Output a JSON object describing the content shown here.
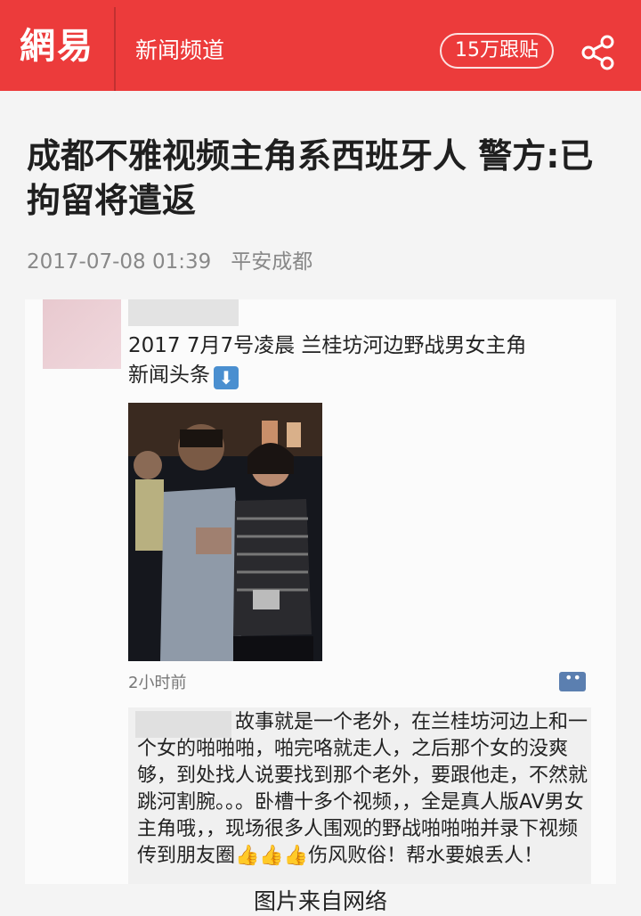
{
  "header": {
    "logo": "網易",
    "channel": "新闻频道",
    "comments": "15万跟贴",
    "share_icon": "share-icon",
    "background": "#ec3b3b"
  },
  "article": {
    "title": "成都不雅视频主角系西班牙人 警方:已拘留将遣返",
    "date": "2017-07-08 01:39",
    "source": "平安成都"
  },
  "screenshot": {
    "post_line1": "2017 7月7号凌晨 兰桂坊河边野战男女主角",
    "post_line2": "新闻头条",
    "time_ago": "2小时前",
    "comment": "故事就是一个老外，在兰桂坊河边上和一个女的啪啪啪，啪完咯就走人，之后那个女的没爽够，到处找人说要找到那个老外，要跟他走，不然就跳河割腕。。。卧槽十多个视频，，全是真人版AV男女主角哦，，现场很多人围观的野战啪啪啪并录下视频传到朋友圈👍👍👍伤风败俗！帮水要娘丢人！"
  },
  "caption": "图片来自网络"
}
